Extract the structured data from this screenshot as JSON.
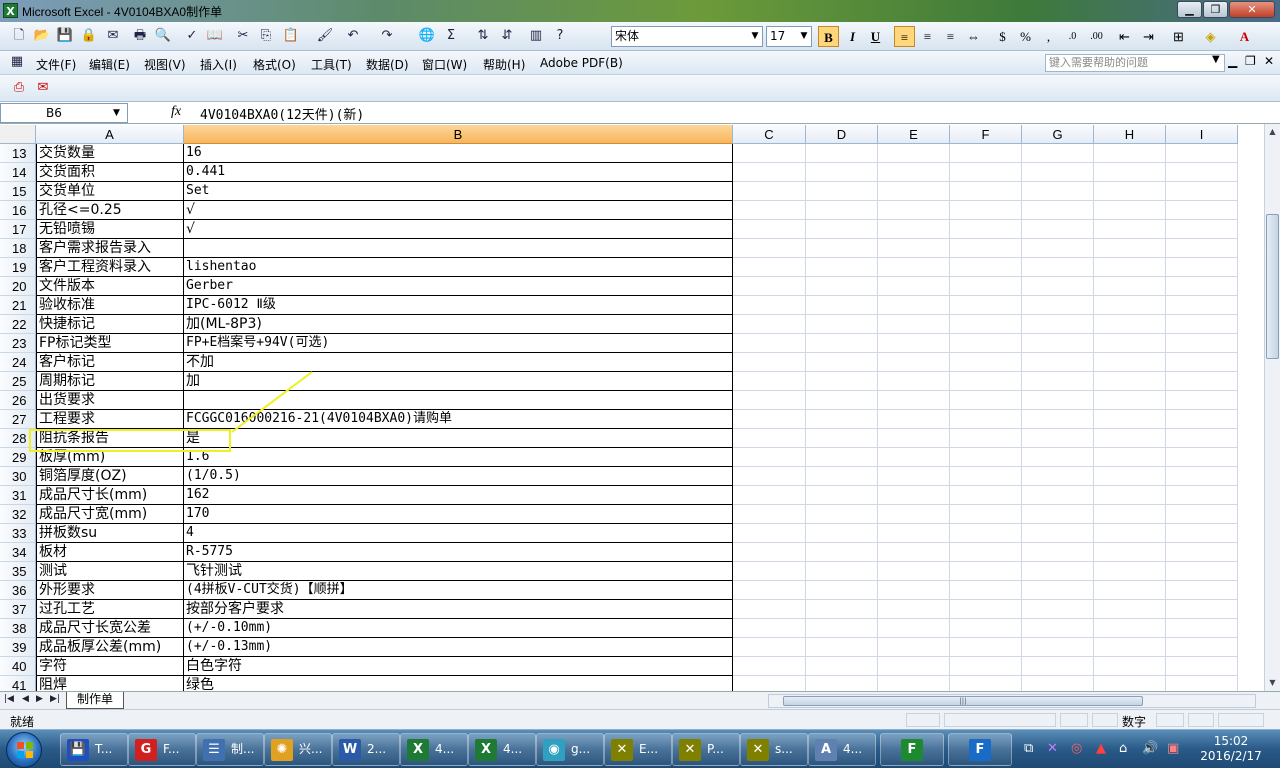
{
  "window": {
    "title": "Microsoft Excel - 4V0104BXA0制作单",
    "app_icon": "excel-icon",
    "buttons": [
      "minimize",
      "restore",
      "close"
    ]
  },
  "font_toolbar": {
    "font_name": "宋体",
    "font_size": "17",
    "bold_active": true,
    "align_left_active": true
  },
  "menu": {
    "items": [
      "文件(F)",
      "编辑(E)",
      "视图(V)",
      "插入(I)",
      "格式(O)",
      "工具(T)",
      "数据(D)",
      "窗口(W)",
      "帮助(H)",
      "Adobe PDF(B)"
    ],
    "help_placeholder": "键入需要帮助的问题"
  },
  "formula_bar": {
    "name_box": "B6",
    "fx": "fx",
    "content": "4V0104BXA0(12天件)(新)"
  },
  "columns": [
    "A",
    "B",
    "C",
    "D",
    "E",
    "F",
    "G",
    "H",
    "I"
  ],
  "selected_column": "B",
  "rows": [
    {
      "num": "13",
      "a": "交货数量",
      "b": "16"
    },
    {
      "num": "14",
      "a": "交货面积",
      "b": "0.441"
    },
    {
      "num": "15",
      "a": "交货单位",
      "b": "Set"
    },
    {
      "num": "16",
      "a": "孔径<=0.25",
      "b": "√"
    },
    {
      "num": "17",
      "a": "无铅喷锡",
      "b": "√"
    },
    {
      "num": "18",
      "a": "客户需求报告录入",
      "b": ""
    },
    {
      "num": "19",
      "a": "客户工程资料录入",
      "b": "lishentao"
    },
    {
      "num": "20",
      "a": "文件版本",
      "b": "Gerber"
    },
    {
      "num": "21",
      "a": "验收标准",
      "b": "IPC-6012 Ⅱ级"
    },
    {
      "num": "22",
      "a": "快捷标记",
      "b": "加(ML-8P3)"
    },
    {
      "num": "23",
      "a": "FP标记类型",
      "b": "FP+E档案号+94V(可选)"
    },
    {
      "num": "24",
      "a": "客户标记",
      "b": "不加"
    },
    {
      "num": "25",
      "a": "周期标记",
      "b": "加"
    },
    {
      "num": "26",
      "a": "出货要求",
      "b": ""
    },
    {
      "num": "27",
      "a": "工程要求",
      "b": "FCGGC016000216-21(4V0104BXA0)请购单"
    },
    {
      "num": "28",
      "a": "阻抗条报告",
      "b": "是"
    },
    {
      "num": "29",
      "a": "板厚(mm)",
      "b": "1.6"
    },
    {
      "num": "30",
      "a": "铜箔厚度(OZ)",
      "b": "(1/0.5)"
    },
    {
      "num": "31",
      "a": "成品尺寸长(mm)",
      "b": "162"
    },
    {
      "num": "32",
      "a": "成品尺寸宽(mm)",
      "b": "170"
    },
    {
      "num": "33",
      "a": "拼板数su",
      "b": "4"
    },
    {
      "num": "34",
      "a": "板材",
      "b": "R-5775"
    },
    {
      "num": "35",
      "a": "测试",
      "b": "飞针测试"
    },
    {
      "num": "36",
      "a": "外形要求",
      "b": "(4拼板V-CUT交货)【顺拼】"
    },
    {
      "num": "37",
      "a": "过孔工艺",
      "b": "按部分客户要求"
    },
    {
      "num": "38",
      "a": "成品尺寸长宽公差",
      "b": "(+/-0.10mm)"
    },
    {
      "num": "39",
      "a": "成品板厚公差(mm)",
      "b": "(+/-0.13mm)"
    },
    {
      "num": "40",
      "a": "字符",
      "b": "白色字符"
    },
    {
      "num": "41",
      "a": "阻焊",
      "b": "绿色"
    }
  ],
  "sheet_tab": "制作单",
  "status": {
    "ready": "就绪",
    "numlock": "数字"
  },
  "taskbar": {
    "buttons": [
      {
        "label": "T...",
        "icon": "floppy-icon"
      },
      {
        "label": "F...",
        "icon": "foxmail-icon"
      },
      {
        "label": "制...",
        "icon": "document-icon"
      },
      {
        "label": "兴...",
        "icon": "shell-icon"
      },
      {
        "label": "2...",
        "icon": "word-icon"
      },
      {
        "label": "4...",
        "icon": "excel-icon"
      },
      {
        "label": "4...",
        "icon": "excel-icon"
      },
      {
        "label": "g...",
        "icon": "eye-icon"
      },
      {
        "label": "E...",
        "icon": "x-window-icon"
      },
      {
        "label": "P...",
        "icon": "x-window-icon"
      },
      {
        "label": "s...",
        "icon": "x-window-icon"
      },
      {
        "label": "4...",
        "icon": "text-document-icon"
      }
    ],
    "time": "15:02",
    "date": "2016/2/17"
  },
  "colors": {
    "selected_header": "#f8b65a",
    "annotation": "#f0f020"
  }
}
